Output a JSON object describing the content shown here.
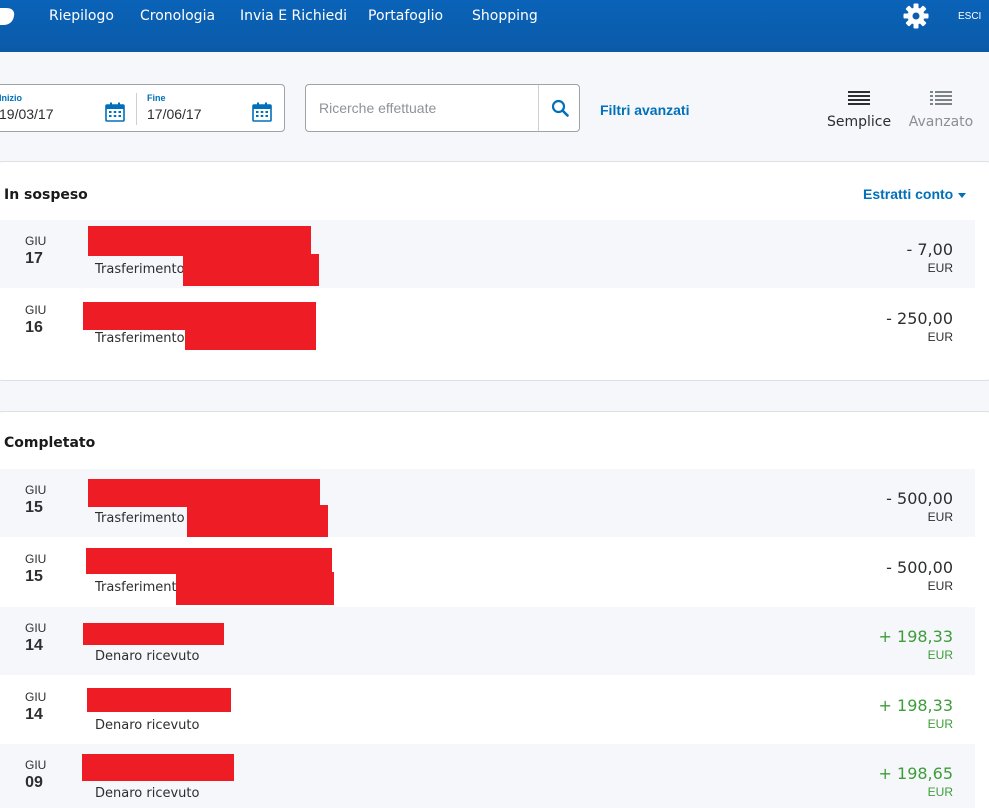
{
  "nav": {
    "items": [
      "Riepilogo",
      "Cronologia",
      "Invia E Richiedi",
      "Portafoglio",
      "Shopping"
    ],
    "logout": "ESCI"
  },
  "filters": {
    "start_label": "Inizio",
    "start_value": "19/03/17",
    "end_label": "Fine",
    "end_value": "17/06/17",
    "search_placeholder": "Ricerche effettuate",
    "advanced_filters": "Filtri avanzati",
    "view_simple": "Semplice",
    "view_advanced": "Avanzato"
  },
  "pending": {
    "title": "In sospeso",
    "statements_link": "Estratti conto",
    "rows": [
      {
        "month": "GIU",
        "day": "17",
        "desc": "Trasferimento",
        "amount": "- 7,00",
        "currency": "EUR"
      },
      {
        "month": "GIU",
        "day": "16",
        "desc": "Trasferimento",
        "amount": "- 250,00",
        "currency": "EUR"
      }
    ]
  },
  "completed": {
    "title": "Completato",
    "rows": [
      {
        "month": "GIU",
        "day": "15",
        "desc": "Trasferimento",
        "amount": "- 500,00",
        "currency": "EUR"
      },
      {
        "month": "GIU",
        "day": "15",
        "desc": "Trasferimento",
        "amount": "- 500,00",
        "currency": "EUR"
      },
      {
        "month": "GIU",
        "day": "14",
        "desc": "Denaro ricevuto",
        "amount": "+ 198,33",
        "currency": "EUR"
      },
      {
        "month": "GIU",
        "day": "14",
        "desc": "Denaro ricevuto",
        "amount": "+ 198,33",
        "currency": "EUR"
      },
      {
        "month": "GIU",
        "day": "09",
        "desc": "Denaro ricevuto",
        "amount": "+ 198,65",
        "currency": "EUR"
      }
    ]
  },
  "colors": {
    "header_blue": "#0b5fb3",
    "link_blue": "#0070ba",
    "positive_green": "#3e9d39",
    "redaction_red": "#ee1c25"
  },
  "icons": {
    "logo": "paypal-logo-icon",
    "settings": "gear-icon",
    "calendar": "calendar-icon",
    "search": "search-icon",
    "simple_view": "list-lines-icon",
    "advanced_view": "list-detail-icon"
  }
}
